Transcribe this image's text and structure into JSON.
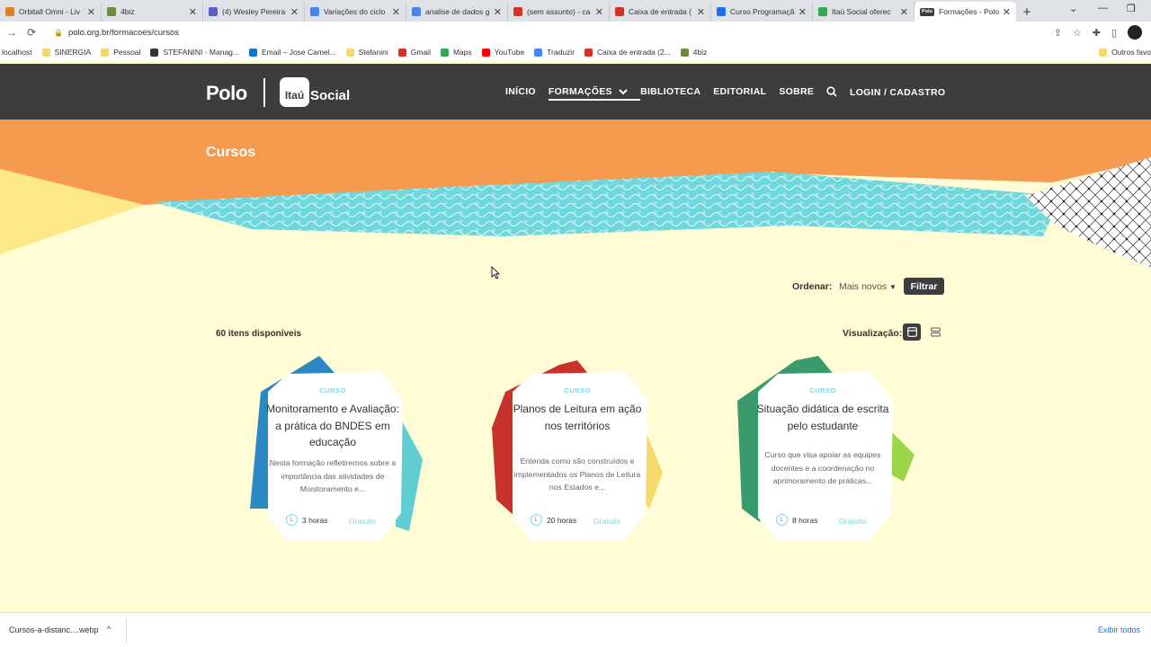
{
  "browser": {
    "tabs": [
      {
        "title": "Orbitall Omni - Liv",
        "color": "#e67e22"
      },
      {
        "title": "4biz",
        "color": "#6d8b3a"
      },
      {
        "title": "(4) Wesley Pereira",
        "color": "#5b5fc7"
      },
      {
        "title": "Variações do ciclo",
        "color": "#4285f4"
      },
      {
        "title": "analise de dados g",
        "color": "#4285f4"
      },
      {
        "title": "(sem assunto) - ca",
        "color": "#d93025"
      },
      {
        "title": "Caixa de entrada (",
        "color": "#d93025"
      },
      {
        "title": "Curso Programação",
        "color": "#1a73e8"
      },
      {
        "title": "Itaú Social oferec",
        "color": "#34a853"
      },
      {
        "title": "Formações - Polo",
        "color": "#3d3d3d"
      }
    ],
    "favicon_text_active": "Polo",
    "new_tab": "+",
    "url": "polo.org.br/formacoes/cursos",
    "bookmarks": [
      {
        "label": "localhost",
        "color": "#e8c34a"
      },
      {
        "label": "SINERGIA",
        "color": "#f5d76e"
      },
      {
        "label": "Pessoal",
        "color": "#f5d76e"
      },
      {
        "label": "STEFANINI - Manag...",
        "color": "#333333"
      },
      {
        "label": "Email – Jose Camel...",
        "color": "#0078d4"
      },
      {
        "label": "Stefanini",
        "color": "#f5d76e"
      },
      {
        "label": "Gmail",
        "color": "#d93025"
      },
      {
        "label": "Maps",
        "color": "#34a853"
      },
      {
        "label": "YouTube",
        "color": "#ff0000"
      },
      {
        "label": "Traduzir",
        "color": "#4285f4"
      },
      {
        "label": "Caixa de entrada (2...",
        "color": "#d93025"
      },
      {
        "label": "4biz",
        "color": "#6d8b3a"
      }
    ],
    "bookmarks_other": "Outros favo"
  },
  "site": {
    "logo_polo": "Polo",
    "logo_itau": "Itaú",
    "logo_social": "Social",
    "nav": [
      "INÍCIO",
      "FORMAÇÕES",
      "BIBLIOTECA",
      "EDITORIAL",
      "SOBRE"
    ],
    "login": "LOGIN / CADASTRO"
  },
  "page": {
    "title": "Cursos",
    "sort_label": "Ordenar:",
    "sort_value": "Mais novos",
    "filter_button": "Filtrar",
    "count": "60 itens disponíveis",
    "view_label": "Visualização:"
  },
  "cards": [
    {
      "kind": "CURSO",
      "title": "Monitoramento e Avaliação: a prática do BNDES em educação",
      "description": "Nesta formação refletiremos sobre a importância das atividades de Monitoramento e...",
      "hours": "3 horas",
      "price": "Gratuito",
      "accent": "#2b8ac4"
    },
    {
      "kind": "CURSO",
      "title": "Planos de Leitura em ação nos territórios",
      "description": "Entenda como são construídos e implementados os Planos de Leitura nos Estados e...",
      "hours": "20 horas",
      "price": "Gratuito",
      "accent": "#c9312b"
    },
    {
      "kind": "CURSO",
      "title": "Situação didática de escrita pelo estudante",
      "description": "Curso que visa apoiar as equipes docentes e a coordenação no aprimoramento de práticas...",
      "hours": "8 horas",
      "price": "Gratuito",
      "accent": "#3a9a6e"
    }
  ],
  "download": {
    "file": "Cursos-a-distanc....webp",
    "show_all": "Exibir todos"
  },
  "colors": {
    "header_bg": "#3d3d3d",
    "hero_orange": "#f59a4f",
    "page_bg": "#fffcd6",
    "accent_cyan": "#7fd6e3"
  }
}
